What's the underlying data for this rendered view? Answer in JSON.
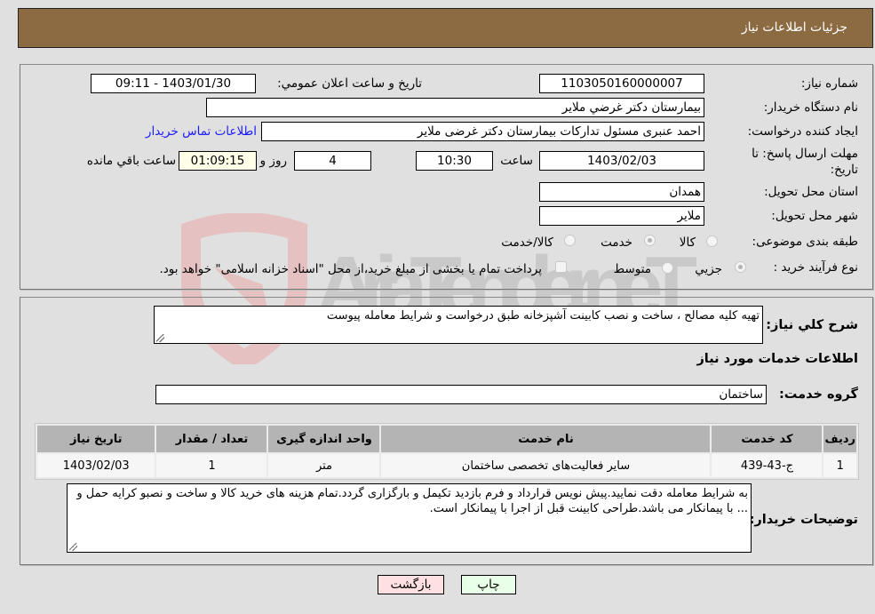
{
  "header": {
    "title": "جزئيات اطلاعات نياز"
  },
  "form": {
    "need_number": {
      "label": "شماره نياز:",
      "value": "1103050160000007"
    },
    "announce_datetime": {
      "label": "تاريخ و ساعت اعلان عمومي:",
      "value": "1403/01/30 - 09:11"
    },
    "buyer_org": {
      "label": "نام دستگاه خريدار:",
      "value": "بيمارستان دكتر غرضي ملاير"
    },
    "requester": {
      "label": "ايجاد كننده درخواست:",
      "value": "احمد عنبری مسئول تدارکات بیمارستان دکتر غرضی ملایر"
    },
    "buyer_contact_link": "اطلاعات تماس خريدار",
    "deadline": {
      "label": "مهلت ارسال پاسخ: تا تاريخ:",
      "date": "1403/02/03",
      "time_label": "ساعت",
      "time": "10:30",
      "days": "4",
      "days_label": "روز و",
      "remaining": "01:09:15",
      "remaining_label": "ساعت باقي مانده"
    },
    "province": {
      "label": "استان محل تحويل:",
      "value": "همدان"
    },
    "city": {
      "label": "شهر محل تحويل:",
      "value": "ملاير"
    },
    "category": {
      "label": "طبقه بندی موضوعی:",
      "options": [
        "كالا",
        "خدمت",
        "كالا/خدمت"
      ],
      "selected": "خدمت"
    },
    "purchase_type": {
      "label": "نوع فرآيند خريد :",
      "options": [
        "جزيي",
        "متوسط"
      ],
      "selected": "جزيي",
      "treasury_checkbox_label": "پرداخت تمام يا بخشی از مبلغ خريد،از محل \"اسناد خزانه اسلامی\" خواهد بود.",
      "treasury_checked": false
    }
  },
  "details": {
    "description_label": "شرح كلي نياز:",
    "description": "تهيه كليه مصالح ، ساخت و نصب كابينت آشپزخانه طبق درخواست و شرايط معامله پيوست",
    "services_heading": "اطلاعات خدمات مورد نياز",
    "service_group_label": "گروه خدمت:",
    "service_group": "ساختمان",
    "table": {
      "headers": [
        "رديف",
        "كد خدمت",
        "نام خدمت",
        "واحد اندازه گيری",
        "تعداد / مقدار",
        "تاريخ نياز"
      ],
      "rows": [
        [
          "1",
          "ج-43-439",
          "ساير فعاليت‌هاى تخصصى ساختمان",
          "متر",
          "1",
          "1403/02/03"
        ]
      ]
    },
    "buyer_notes_label": "توضيحات خريدار:",
    "buyer_notes": "به شرايط معامله دقت نماييد.پيش نويس قرارداد و فرم بازديد تكيمل و بارگزاری گردد.تمام هزينه های خريد كالا و ساخت و نصبو كرايه حمل و ... با پيمانكار می باشد.طراحی كابينت قبل از اجرا با پيمانكار است."
  },
  "buttons": {
    "back": "بازگشت",
    "print": "چاپ"
  },
  "watermark": {
    "text": "AriaTender.neT"
  },
  "colors": {
    "header_bg": "#8c6b42",
    "link": "#1a1aff",
    "back_bg": "#ffe0e0",
    "print_bg": "#e8ffe8",
    "remaining_bg": "#ffffe8"
  }
}
